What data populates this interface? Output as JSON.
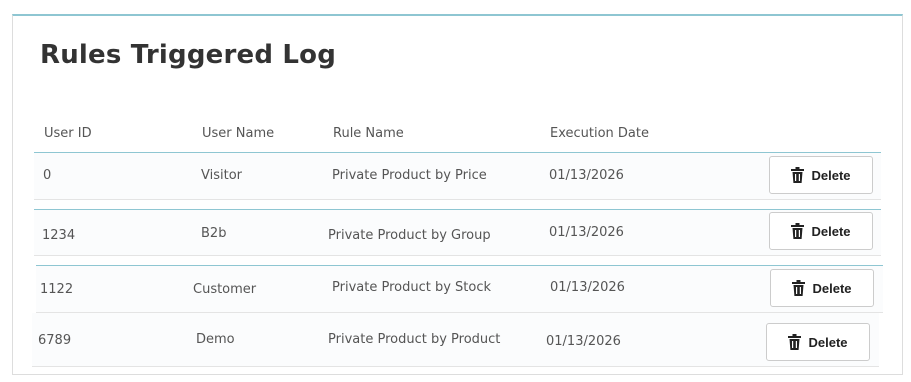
{
  "page": {
    "title": "Rules Triggered Log"
  },
  "table": {
    "headers": {
      "user_id": "User ID",
      "user_name": "User Name",
      "rule_name": "Rule Name",
      "execution_date": "Execution Date"
    },
    "rows": [
      {
        "user_id": "0",
        "user_name": "Visitor",
        "rule_name": "Private Product by Price",
        "execution_date": "01/13/2026",
        "action": "Delete"
      },
      {
        "user_id": "1234",
        "user_name": "B2b",
        "rule_name": "Private Product by Group",
        "execution_date": "01/13/2026",
        "action": "Delete"
      },
      {
        "user_id": "1122",
        "user_name": "Customer",
        "rule_name": "Private Product by Stock",
        "execution_date": "01/13/2026",
        "action": "Delete"
      },
      {
        "user_id": "6789",
        "user_name": "Demo",
        "rule_name": "Private Product by Product",
        "execution_date": "01/13/2026",
        "action": "Delete"
      }
    ]
  },
  "icons": {
    "delete": "trash-icon"
  },
  "colors": {
    "accent_line": "#8ec6d2",
    "text": "#555555",
    "title": "#333333"
  }
}
